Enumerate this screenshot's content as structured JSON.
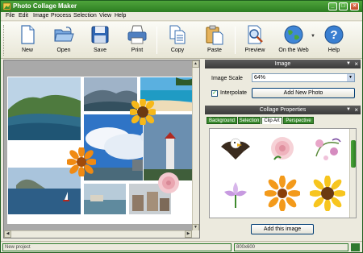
{
  "app": {
    "title": "Photo Collage Maker"
  },
  "menu": [
    "File",
    "Edit",
    "Image",
    "Process",
    "Selection",
    "View",
    "Help"
  ],
  "toolbar": {
    "new": "New",
    "open": "Open",
    "save": "Save",
    "print": "Print",
    "copy": "Copy",
    "paste": "Paste",
    "preview": "Preview",
    "on_the_web": "On the Web",
    "help": "Help"
  },
  "image_panel": {
    "title": "Image",
    "scale_label": "Image Scale",
    "scale_value": "64%",
    "interpolate_label": "Interpolate",
    "interpolate_checked": true,
    "add_photo_label": "Add New Photo"
  },
  "collage_panel": {
    "title": "Collage Properties",
    "tabs": [
      "Background",
      "Selection",
      "Clip Art",
      "Perspective"
    ],
    "active_tab": "Clip Art",
    "clipart": [
      "eagle",
      "pink-rose",
      "floral-ornament",
      "purple-lily",
      "orange-gerbera",
      "yellow-sunflower"
    ],
    "add_image_label": "Add this image"
  },
  "status": {
    "left": "New project",
    "right": "800x600"
  },
  "colors": {
    "accent_green": "#2e7a2e",
    "panel_head": "#4a4a4a",
    "tab_green": "#3b8a2f"
  }
}
